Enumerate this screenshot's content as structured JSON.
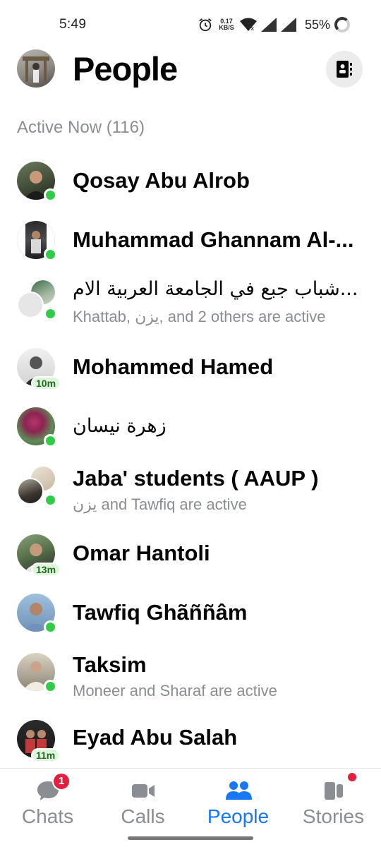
{
  "status_bar": {
    "time": "5:49",
    "speed_value": "0.17",
    "speed_unit": "KB/S",
    "battery": "55%",
    "icons": [
      "alarm-icon",
      "wifi-icon",
      "signal-icon",
      "signal-icon",
      "battery-icon"
    ]
  },
  "header": {
    "title": "People",
    "right_icon": "contacts-book-icon"
  },
  "section": {
    "title": "Active Now (116)"
  },
  "people": [
    {
      "name": "Qosay Abu Alrob",
      "subtitle": "",
      "status": "online"
    },
    {
      "name": "Muhammad Ghannam Al-...",
      "subtitle": "",
      "status": "online"
    },
    {
      "name": "...شباب جبع في الجامعة العربية الام",
      "subtitle": "Khattab, يزن, and 2 others are active",
      "status": "online"
    },
    {
      "name": "Mohammed Hamed",
      "subtitle": "",
      "status": "10m"
    },
    {
      "name": "زهرة نيسان",
      "subtitle": "",
      "status": "online"
    },
    {
      "name": "Jaba' students ( AAUP )",
      "subtitle": "يزن and Tawfiq are active",
      "status": "online"
    },
    {
      "name": "Omar Hantoli",
      "subtitle": "",
      "status": "13m"
    },
    {
      "name": "Tawfiq Ghãññâm",
      "subtitle": "",
      "status": "online"
    },
    {
      "name": "Taksim",
      "subtitle": "Moneer and Sharaf are active",
      "status": "online"
    },
    {
      "name": "Eyad Abu Salah",
      "subtitle": "",
      "status": "11m"
    }
  ],
  "bottom_nav": {
    "chats": {
      "label": "Chats",
      "badge": "1",
      "icon": "chat-bubble-icon"
    },
    "calls": {
      "label": "Calls",
      "icon": "video-camera-icon"
    },
    "people": {
      "label": "People",
      "icon": "people-icon",
      "active": true
    },
    "stories": {
      "label": "Stories",
      "icon": "stories-icon",
      "has_dot": true
    }
  },
  "colors": {
    "accent": "#1877f2",
    "online": "#31cc46",
    "badge": "#e41e3f",
    "muted": "#8a8d91"
  }
}
